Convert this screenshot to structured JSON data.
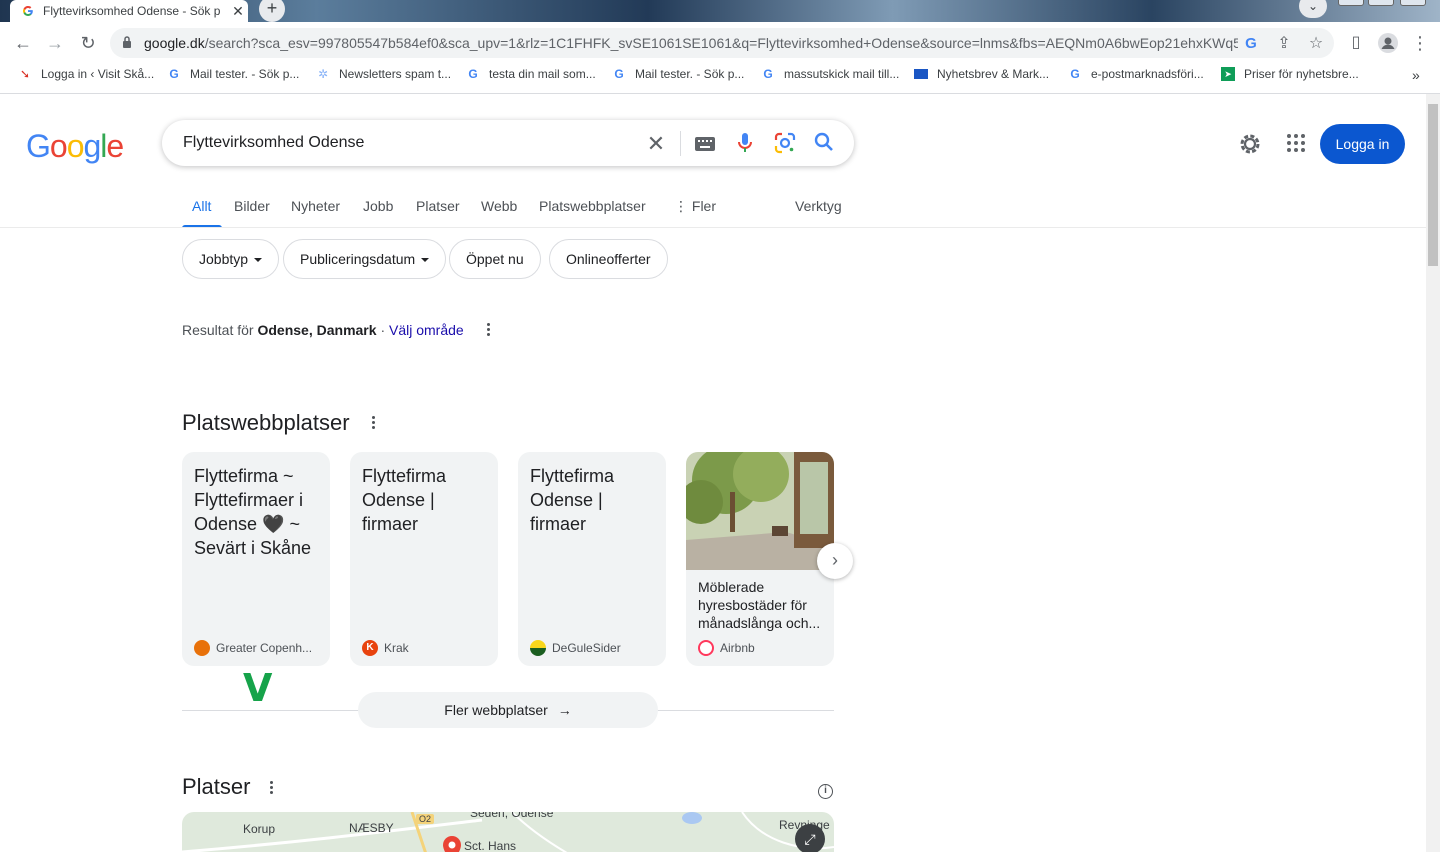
{
  "browser": {
    "tab_title": "Flyttevirksomhed Odense - Sök p",
    "url_host": "google.dk",
    "url_rest": "/search?sca_esv=997805547b584ef0&sca_upv=1&rlz=1C1FHFK_svSE1061SE1061&q=Flyttevirksomhed+Odense&source=lnms&fbs=AEQNm0A6bwEop21ehxKWq5c...",
    "bookmarks": [
      {
        "label": "Logga in ‹ Visit Skå...",
        "icon": "arrow-icon",
        "color": "#d93025"
      },
      {
        "label": "Mail tester. - Sök p...",
        "icon": "google-icon",
        "color": "#4285f4"
      },
      {
        "label": "Newsletters spam t...",
        "icon": "gear-icon",
        "color": "#8ab4f8"
      },
      {
        "label": "testa din mail som...",
        "icon": "google-icon",
        "color": "#4285f4"
      },
      {
        "label": "Mail tester. - Sök p...",
        "icon": "google-icon",
        "color": "#4285f4"
      },
      {
        "label": "massutskick mail till...",
        "icon": "google-icon",
        "color": "#4285f4"
      },
      {
        "label": "Nyhetsbrev & Mark...",
        "icon": "flag-icon",
        "color": "#1a56c4"
      },
      {
        "label": "e-postmarknadsföri...",
        "icon": "google-icon",
        "color": "#4285f4"
      },
      {
        "label": "Priser för nyhetsbre...",
        "icon": "send-icon",
        "color": "#0f9d58"
      }
    ]
  },
  "search": {
    "query": "Flyttevirksomhed Odense",
    "login_label": "Logga in"
  },
  "tabs": [
    "Allt",
    "Bilder",
    "Nyheter",
    "Jobb",
    "Platser",
    "Webb",
    "Platswebbplatser",
    "Fler",
    "Verktyg"
  ],
  "chips": [
    "Jobbtyp",
    "Publiceringsdatum",
    "Öppet nu",
    "Onlineofferter"
  ],
  "results_for": {
    "prefix": "Resultat för",
    "location": "Odense, Danmark",
    "separator": "·",
    "link": "Välj område"
  },
  "websites_section": {
    "title": "Platswebbplatser",
    "cards": [
      {
        "title": "Flyttefirma ~ Flyttefirmaer i Odense 🖤 ~ Sevärt i Skåne",
        "source": "Greater Copenh...",
        "source_color": "#e8710a"
      },
      {
        "title": "Flyttefirma Odense | firmaer",
        "source": "Krak",
        "source_color": "#e8430e"
      },
      {
        "title": "Flyttefirma Odense | firmaer",
        "source": "DeGuleSider",
        "source_color": "#f9d71c"
      },
      {
        "title": "Möblerade hyresbostäder för månadslånga och...",
        "source": "Airbnb",
        "source_color": "#ff385c"
      }
    ],
    "annotation": "V",
    "more_label": "Fler webbplatser"
  },
  "places_section": {
    "title": "Platser",
    "map_labels": [
      "Korup",
      "NÆSBY",
      "O2",
      "Seden, Odense",
      "Sct. Hans",
      "Revninge"
    ]
  },
  "colors": {
    "accent": "#1a73e8",
    "login_bg": "#0b57d0",
    "link": "#1a0dab"
  }
}
